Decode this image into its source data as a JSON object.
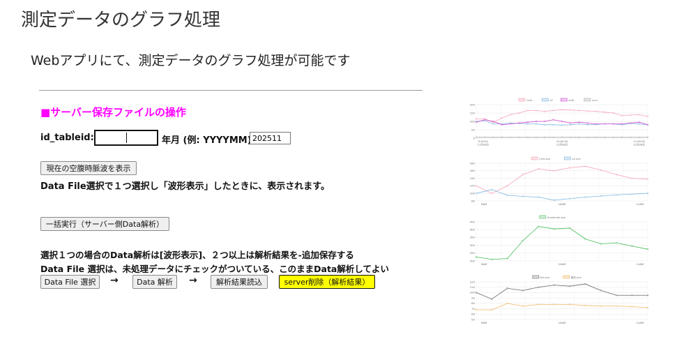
{
  "slide": {
    "title": "測定データのグラフ処理",
    "subtitle": "Webアプリにて、測定データのグラフ処理が可能です"
  },
  "form": {
    "section_heading": "■サーバー保存ファイルの操作",
    "tableid_label": "id_tableid:",
    "tableid_value": "",
    "yearmonth_label": "年月 (例: YYYYMM):",
    "yearmonth_value": "202511",
    "show_wave_button": "現在の空腹時脈波を表示",
    "note_datafile": "Data File選択で１つ選択し「波形表示」したときに、表示されます。",
    "batch_button": "一括実行（サーバー側Data解析）",
    "note_analysis_1": "選択１つの場合のData解析は[波形表示]、２つ以上は解析結果を-追加保存する",
    "note_analysis_2": "Data File 選択は、未処理データにチェックがついている、このままData解析してよい",
    "select_file_button": "Data File 選択",
    "arrow_1": "→",
    "analyze_button": "Data 解析",
    "arrow_2": "→",
    "load_results_button": "解析結果読込",
    "delete_button": "server削除（解析結果）"
  },
  "chart_data": [
    {
      "type": "line",
      "legend_placement": "top",
      "grid": true,
      "ylim": [
        0,
        200
      ],
      "y_ticks": [
        "200",
        "150",
        "100",
        "50",
        "0"
      ],
      "x_tick_labels": [
        [
          "9:00:00",
          "11月28日"
        ],
        [
          "10:00:00",
          "11月28日"
        ],
        [
          "11:00:00",
          "11月28日"
        ]
      ],
      "x": [
        0,
        1,
        2,
        3,
        4,
        5,
        6,
        7,
        8,
        9,
        10,
        11,
        12,
        13,
        14,
        15,
        16,
        17,
        18,
        19,
        20
      ],
      "x_range": [
        0,
        20
      ],
      "x_tick_positions": [
        0.8,
        10,
        19
      ],
      "series": [
        {
          "name": "Carb",
          "color": "#f4a3b5",
          "fill": "#fbe0e6",
          "values": [
            115,
            115,
            95,
            120,
            140,
            150,
            165,
            165,
            160,
            165,
            170,
            168,
            165,
            162,
            160,
            155,
            150,
            135,
            138,
            140,
            130
          ]
        },
        {
          "name": "a2",
          "color": "#7fb8e0",
          "fill": "#dbeaf6",
          "values": [
            100,
            105,
            85,
            85,
            90,
            88,
            85,
            85,
            80,
            80,
            78,
            80,
            85,
            80,
            82,
            85,
            85,
            80,
            88,
            85,
            80
          ]
        },
        {
          "name": "a2dt",
          "color": "#cc44cc",
          "fill": "#f2d0f2",
          "values": [
            95,
            110,
            100,
            80,
            85,
            90,
            95,
            100,
            100,
            110,
            100,
            90,
            95,
            90,
            85,
            85,
            85,
            85,
            90,
            95,
            80
          ]
        },
        {
          "name": "num",
          "color": "#aaaaaa",
          "fill": "#e6e6e6",
          "values": [
            5,
            5,
            5,
            5,
            5,
            5,
            5,
            5,
            5,
            5,
            5,
            5,
            5,
            5,
            5,
            5,
            5,
            5,
            5,
            5,
            5
          ]
        }
      ]
    },
    {
      "type": "line",
      "legend_placement": "top",
      "grid": true,
      "ylim": [
        80,
        180
      ],
      "y_ticks": [
        "180",
        "160",
        "140",
        "120",
        "100",
        "80"
      ],
      "x_tick_labels": [
        "9AM",
        "10AM",
        "11AM"
      ],
      "x": [
        0,
        1,
        2,
        3,
        4,
        5,
        6,
        7,
        8,
        9,
        10,
        11
      ],
      "x_range": [
        0,
        11
      ],
      "x_tick_positions": [
        0.5,
        5.5,
        10.5
      ],
      "series": [
        {
          "name": "Carb-ave",
          "color": "#f4a3b5",
          "fill": "#fbe0e6",
          "values": [
            120,
            100,
            120,
            150,
            165,
            160,
            168,
            172,
            162,
            150,
            140,
            138
          ]
        },
        {
          "name": "a2-ave",
          "color": "#7fb8e0",
          "fill": "#dbeaf6",
          "values": [
            100,
            110,
            95,
            92,
            90,
            82,
            86,
            90,
            93,
            96,
            98,
            100
          ]
        }
      ]
    },
    {
      "type": "line",
      "legend_placement": "top",
      "grid": true,
      "ylim": [
        200,
        450
      ],
      "y_ticks": [
        "450",
        "400",
        "350",
        "300",
        "250",
        "200"
      ],
      "x_tick_labels": [
        "9AM",
        "10AM",
        "11AM"
      ],
      "x": [
        0,
        1,
        2,
        3,
        4,
        5,
        6,
        7,
        8,
        9,
        10,
        11
      ],
      "x_range": [
        0,
        11
      ],
      "x_tick_positions": [
        0.5,
        5.5,
        10.5
      ],
      "series": [
        {
          "name": "Amplitude-ave",
          "color": "#44bb55",
          "fill": "#d6f0da",
          "values": [
            225,
            210,
            215,
            330,
            420,
            405,
            410,
            340,
            310,
            315,
            295,
            275
          ]
        }
      ]
    },
    {
      "type": "line",
      "legend_placement": "top",
      "grid": true,
      "ylim": [
        50,
        120
      ],
      "y_ticks": [
        "120",
        "110",
        "100",
        "90",
        "80",
        "70",
        "60",
        "50"
      ],
      "x_tick_labels": [
        "9AM",
        "10AM",
        "11AM"
      ],
      "x": [
        0,
        1,
        2,
        3,
        4,
        5,
        6,
        7,
        8,
        9,
        10,
        11
      ],
      "x_range": [
        0,
        11
      ],
      "x_tick_positions": [
        0.5,
        5.5,
        10.5
      ],
      "series": [
        {
          "name": "b/a-ave",
          "color": "#666666",
          "fill": "#dddddd",
          "values": [
            100,
            88,
            108,
            104,
            110,
            114,
            112,
            116,
            104,
            95,
            95,
            95
          ]
        },
        {
          "name": "脈拍-ave",
          "color": "#f0b866",
          "fill": "#fbe8cc",
          "values": [
            68,
            68,
            80,
            75,
            78,
            78,
            78,
            76,
            75,
            75,
            74,
            72
          ]
        }
      ]
    }
  ]
}
